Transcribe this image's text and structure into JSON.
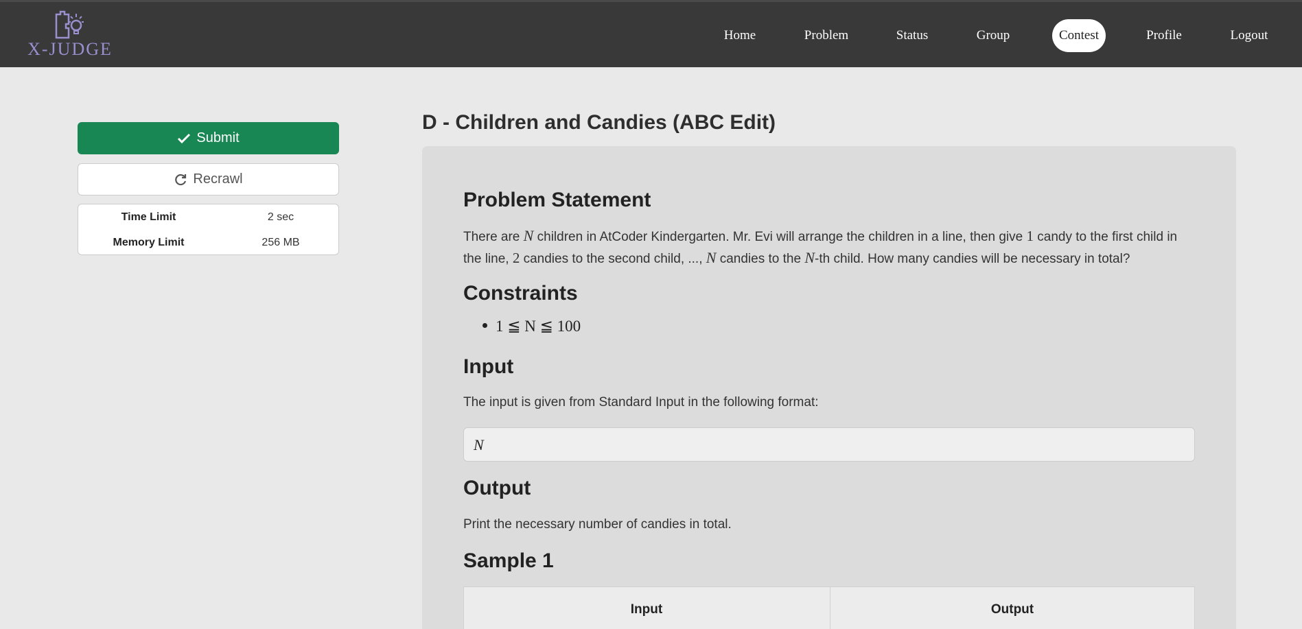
{
  "header": {
    "logo_text": "X-JUDGE",
    "nav": [
      {
        "label": "Home",
        "active": false
      },
      {
        "label": "Problem",
        "active": false
      },
      {
        "label": "Status",
        "active": false
      },
      {
        "label": "Group",
        "active": false
      },
      {
        "label": "Contest",
        "active": true
      },
      {
        "label": "Profile",
        "active": false
      },
      {
        "label": "Logout",
        "active": false
      }
    ]
  },
  "sidebar": {
    "submit_label": "Submit",
    "recrawl_label": "Recrawl",
    "limits": [
      {
        "key": "Time Limit",
        "value": "2 sec"
      },
      {
        "key": "Memory Limit",
        "value": "256 MB"
      }
    ]
  },
  "problem": {
    "title": "D - Children and Candies (ABC Edit)",
    "statement_heading": "Problem Statement",
    "statement_parts": {
      "a": "There are ",
      "N1": "N",
      "b": " children in AtCoder Kindergarten. Mr. Evi will arrange the children in a line, then give ",
      "one": "1",
      "c": " candy to the first child in the line, ",
      "two": "2",
      "d": " candies to the second child, ..., ",
      "N2": "N",
      "e": " candies to the ",
      "N3": "N",
      "f": "-th child. How many candies will be necessary in total?"
    },
    "constraints_heading": "Constraints",
    "constraint": "1 ≦ N ≦ 100",
    "input_heading": "Input",
    "input_text": "The input is given from Standard Input in the following format:",
    "input_format": "N",
    "output_heading": "Output",
    "output_text": "Print the necessary number of candies in total.",
    "sample_heading": "Sample 1",
    "sample_columns": [
      "Input",
      "Output"
    ]
  },
  "colors": {
    "navbar": "#393939",
    "submit": "#198754",
    "logo": "#9a8fcf"
  }
}
